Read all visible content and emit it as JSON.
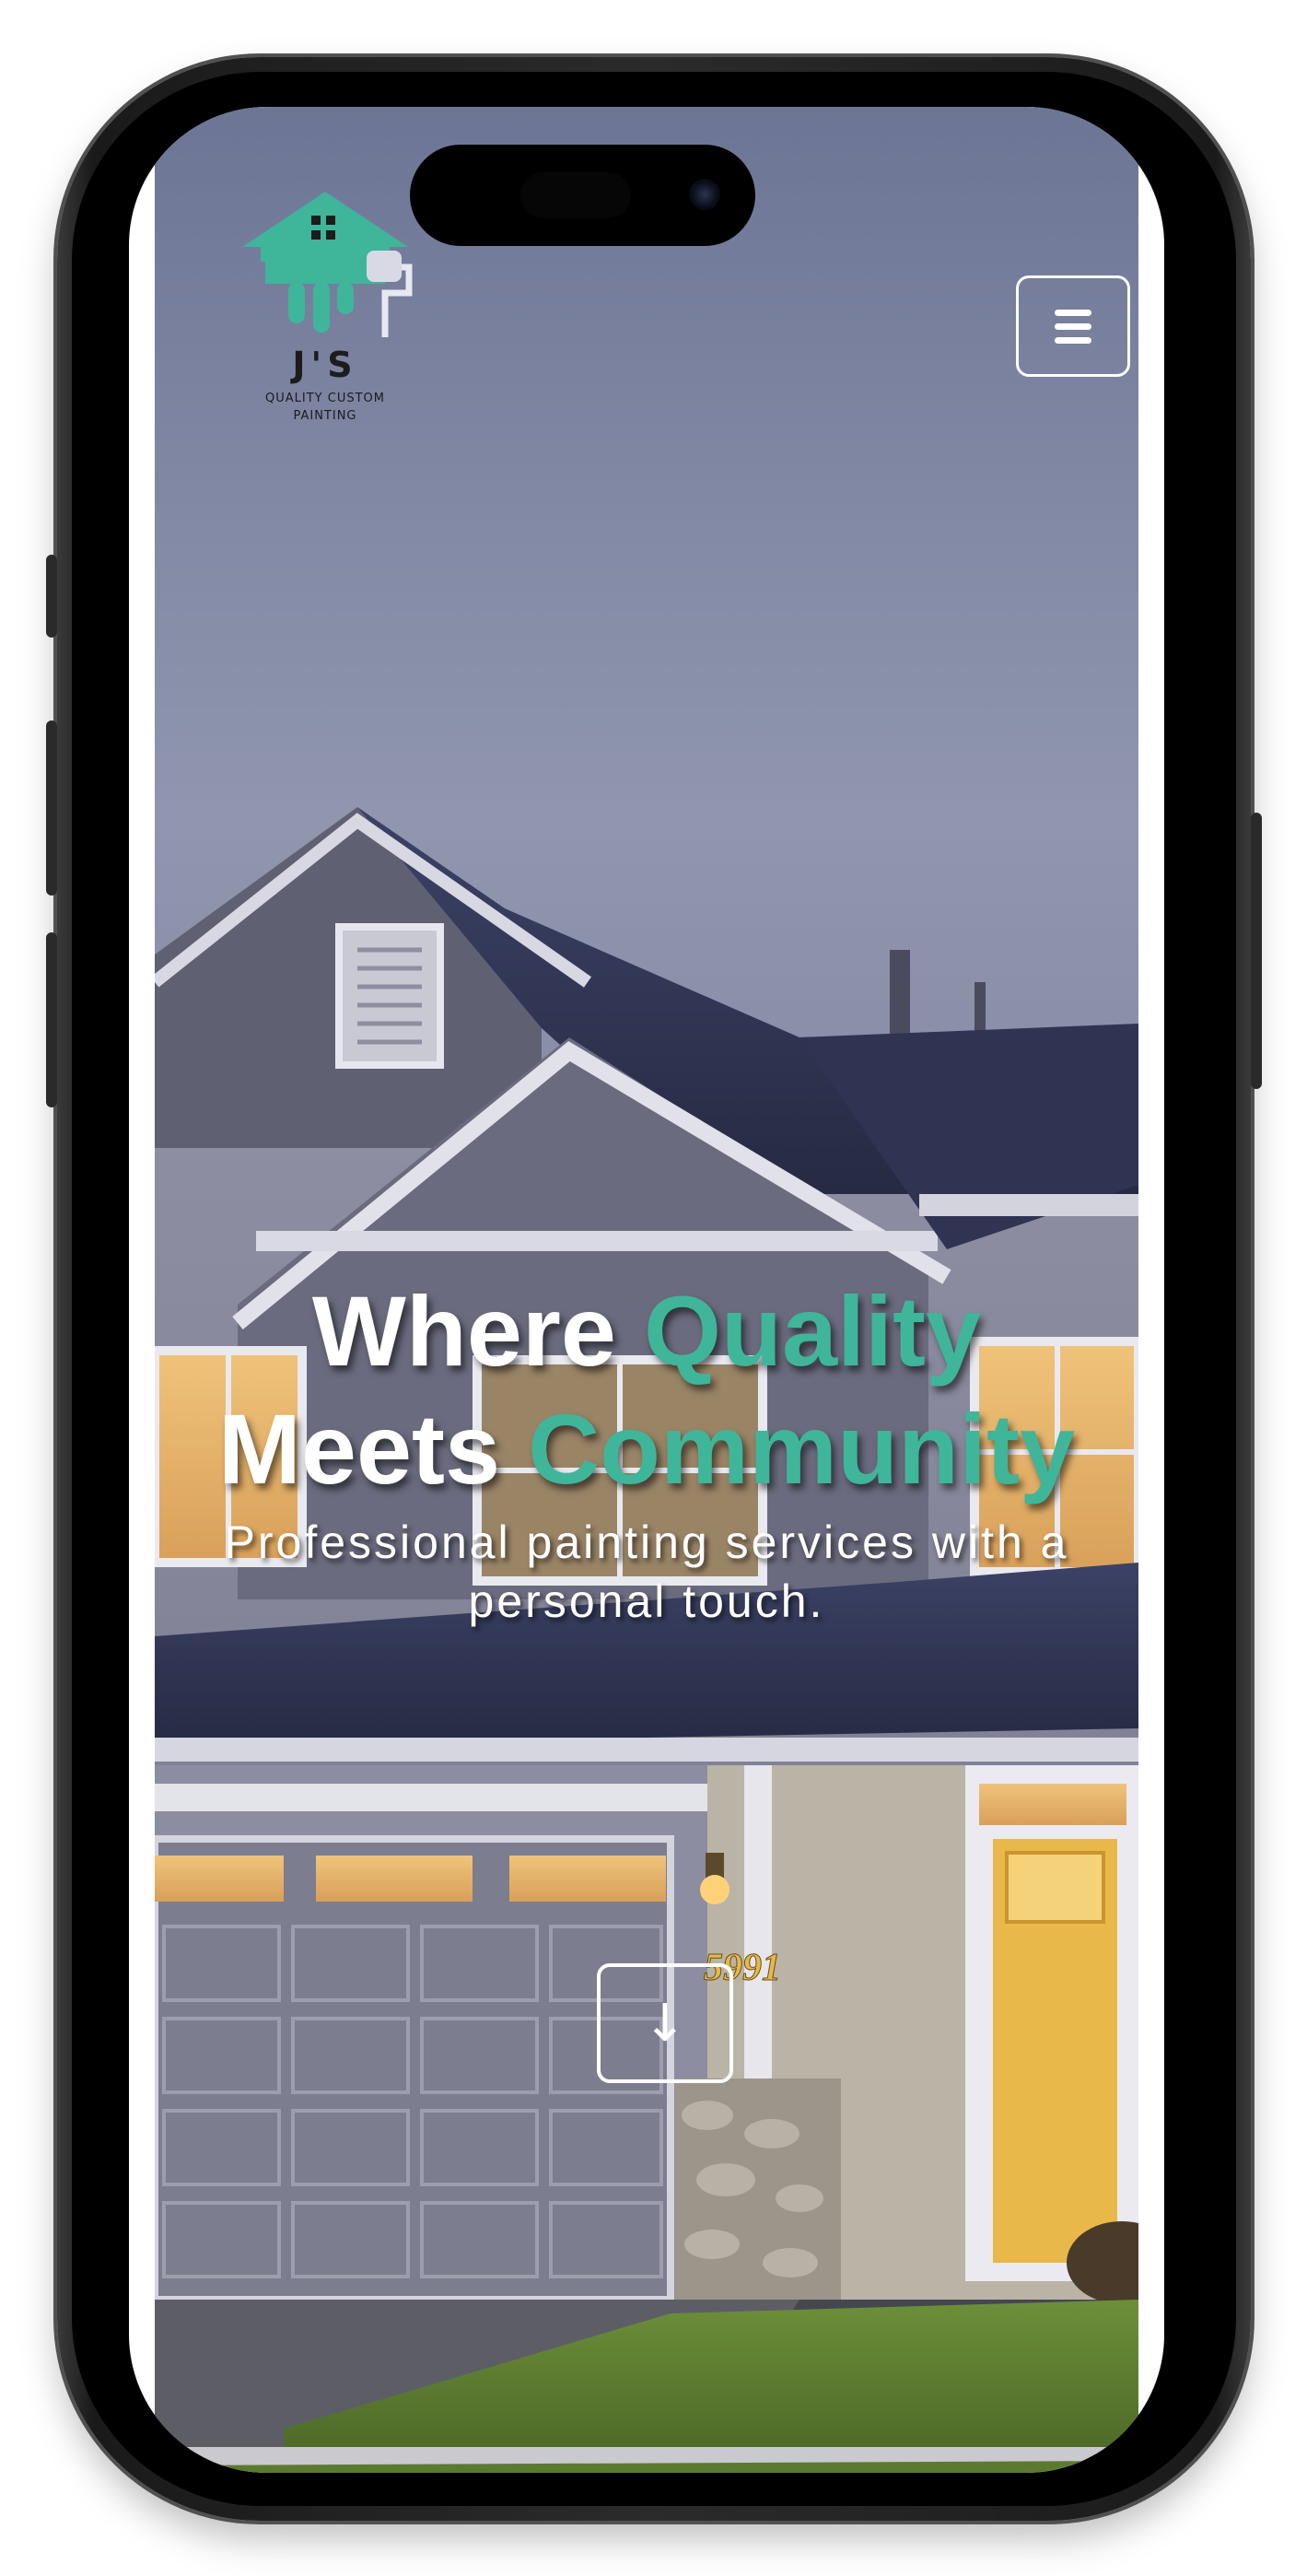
{
  "brand": {
    "name": "J'S",
    "tagline_line1": "QUALITY CUSTOM",
    "tagline_line2": "PAINTING",
    "logo_icon": "house-paint-roller-icon",
    "accent_color": "#3fb59a"
  },
  "header": {
    "menu_icon": "hamburger-menu-icon"
  },
  "hero": {
    "headline_part1": "Where ",
    "headline_accent1": "Quality",
    "headline_part2": "Meets ",
    "headline_accent2": "Community",
    "subheading": "Professional painting services with a personal touch.",
    "house_number": "5991",
    "scroll_icon": "down-arrow-icon",
    "scroll_glyph": "↓"
  }
}
